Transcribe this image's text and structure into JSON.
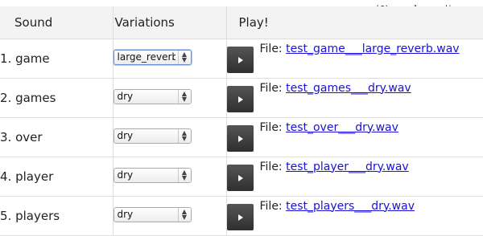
{
  "credit": "(C) www.leevaudio.com",
  "headers": {
    "sound": "Sound",
    "variations": "Variations",
    "play": "Play!"
  },
  "file_prefix": "File:",
  "rows": [
    {
      "name": "1. game",
      "variation": "large_reverb",
      "file": "test_game___large_reverb.wav"
    },
    {
      "name": "2. games",
      "variation": "dry",
      "file": "test_games___dry.wav"
    },
    {
      "name": "3. over",
      "variation": "dry",
      "file": "test_over___dry.wav"
    },
    {
      "name": "4. player",
      "variation": "dry",
      "file": "test_player___dry.wav"
    },
    {
      "name": "5. players",
      "variation": "dry",
      "file": "test_players___dry.wav"
    }
  ],
  "icons": {
    "play": "play-icon",
    "select_arrows": "updown-arrows-icon"
  },
  "colors": {
    "link": "#1a12d6",
    "header_bg": "#f3f3f3",
    "play_button": "#3a3a3a"
  }
}
